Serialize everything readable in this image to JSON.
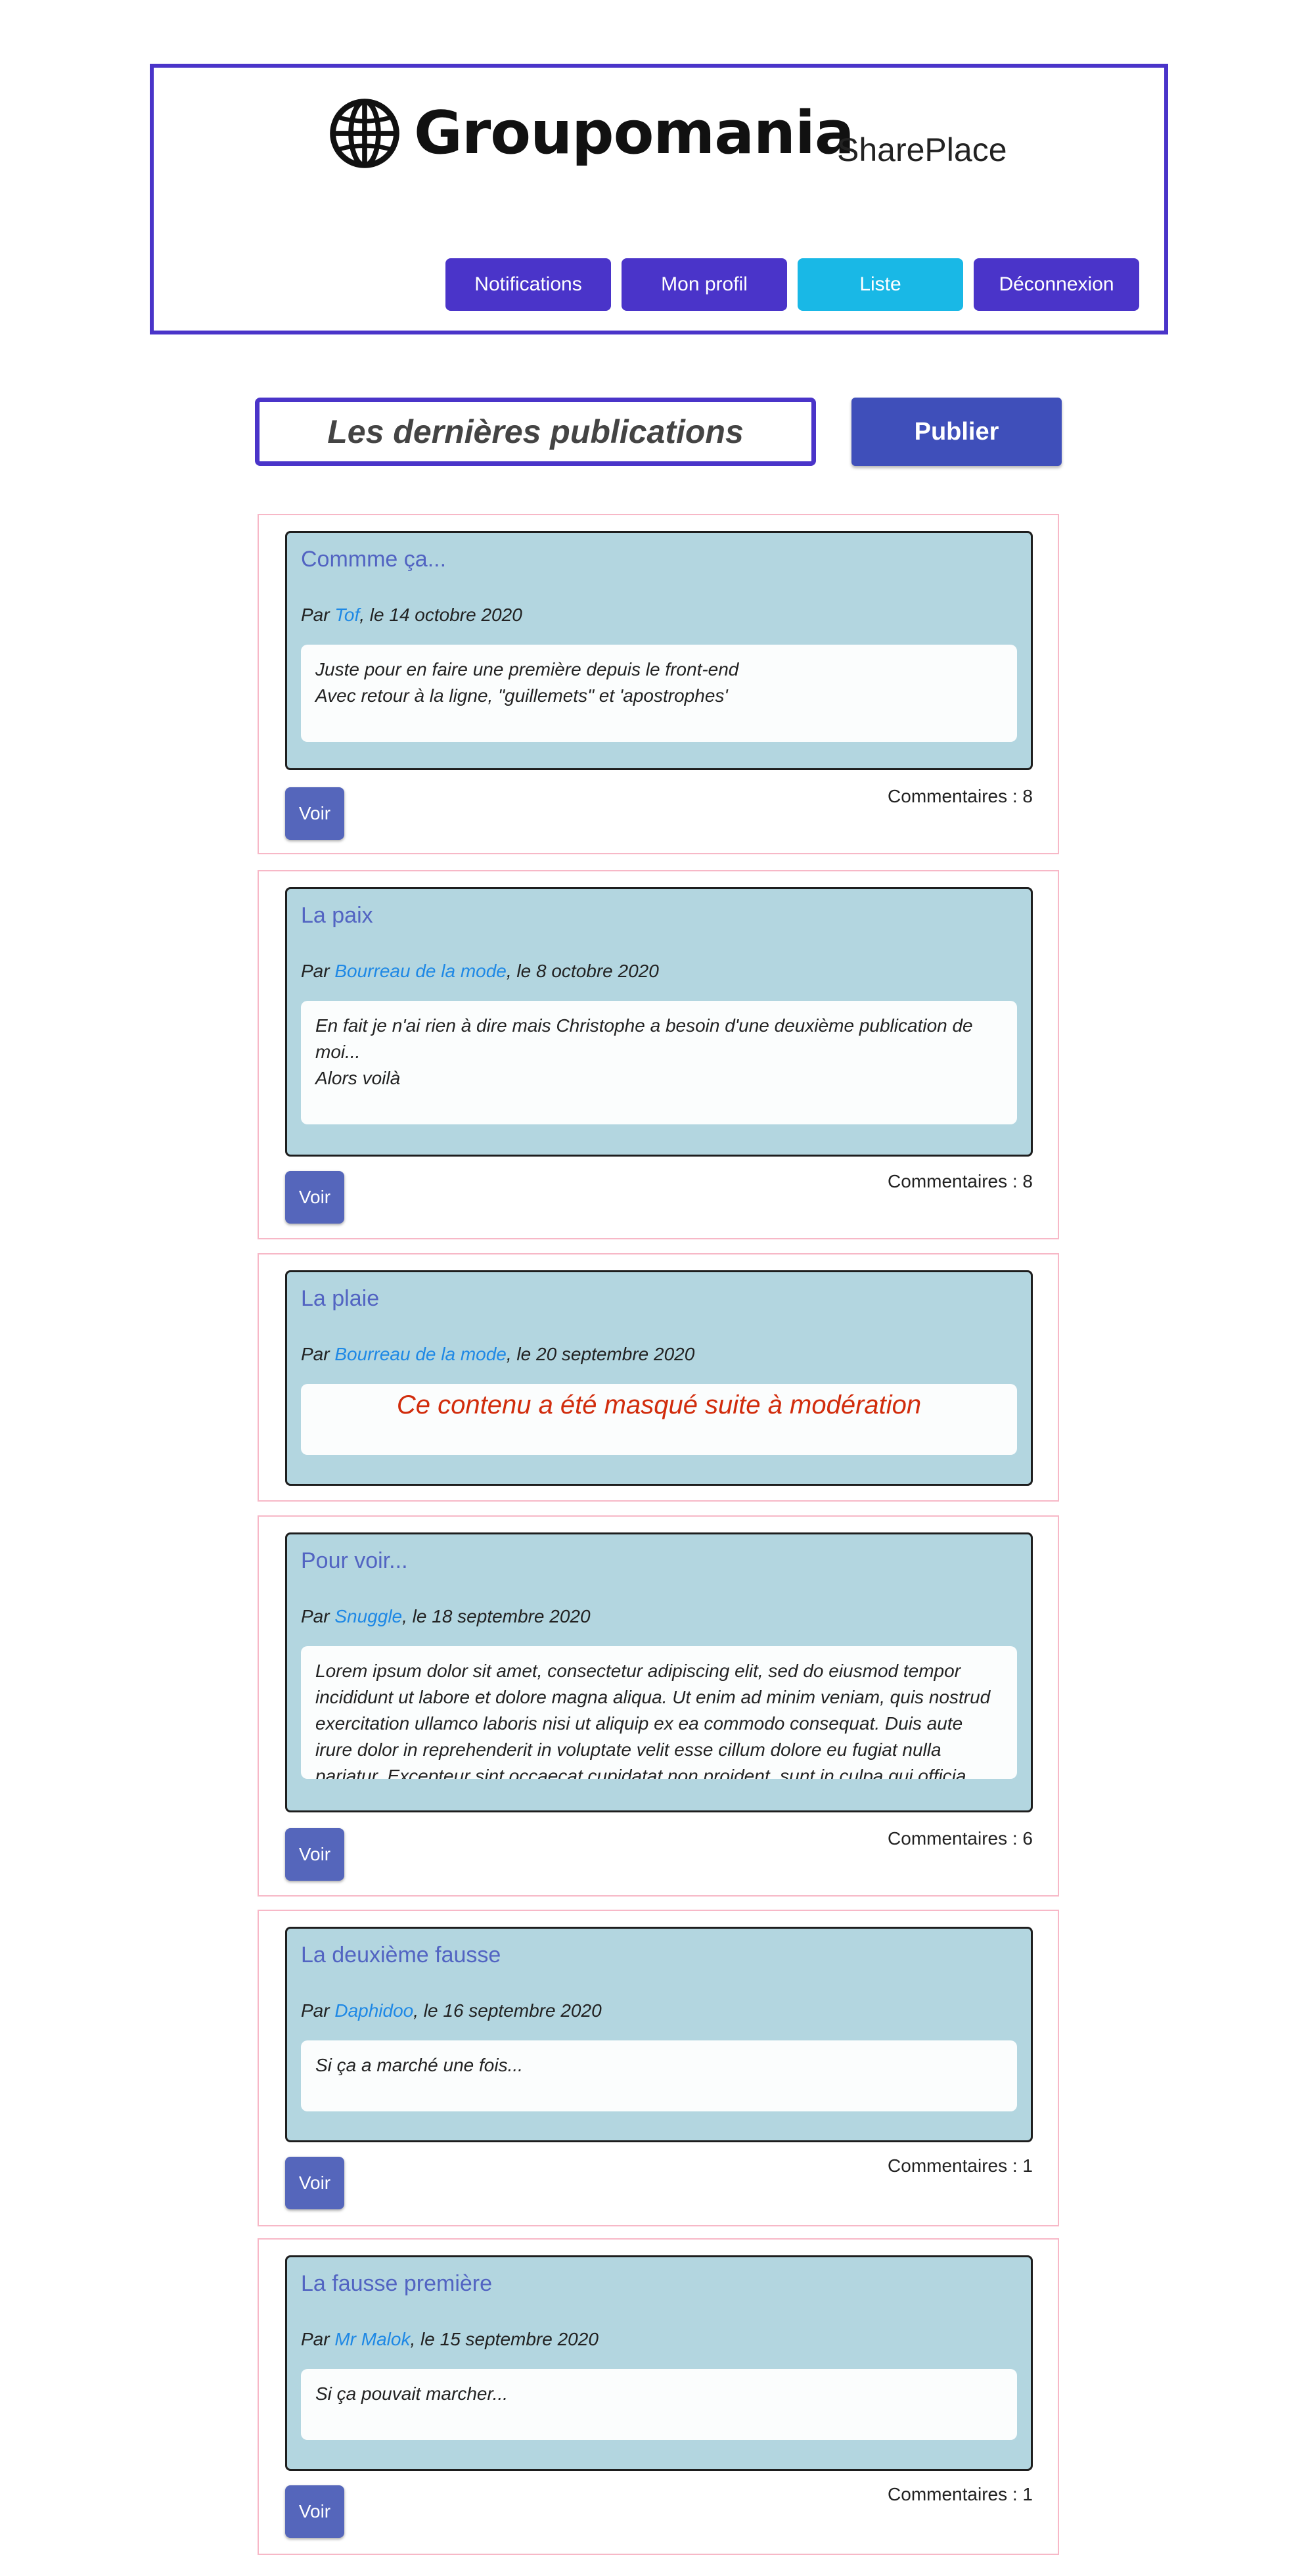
{
  "header": {
    "brand": "Groupomania",
    "tagline": "SharePlace",
    "nav": [
      "Notifications",
      "Mon profil",
      "Liste",
      "Déconnexion"
    ],
    "active_nav": "Liste",
    "colors": {
      "primary": "#4a34c9",
      "active": "#19b8e6"
    }
  },
  "main": {
    "title": "Les dernières publications",
    "publish_label": "Publier"
  },
  "posts": [
    {
      "title": "Commme ça...",
      "by": "Par ",
      "author": "Tof",
      "date": ", le 14 octobre 2020",
      "body": "Juste pour en faire une première depuis le front-end\nAvec retour à la ligne, \"guillemets\" et 'apostrophes'",
      "comments": "Commentaires : 8",
      "voir": "Voir"
    },
    {
      "title": "La paix",
      "by": "Par ",
      "author": "Bourreau de la mode",
      "date": ", le 8 octobre 2020",
      "body": "En fait je n'ai rien à dire mais Christophe a besoin d'une deuxième publication de moi...\nAlors voilà",
      "comments": "Commentaires : 8",
      "voir": "Voir"
    },
    {
      "title": "La plaie",
      "by": "Par ",
      "author": "Bourreau de la mode",
      "date": ", le 20 septembre 2020",
      "body": "Ce contenu a été masqué suite à modération",
      "masked": true
    },
    {
      "title": "Pour voir...",
      "by": "Par ",
      "author": "Snuggle",
      "date": ", le 18 septembre 2020",
      "body": "Lorem ipsum dolor sit amet, consectetur adipiscing elit, sed do eiusmod tempor incididunt ut labore et dolore magna aliqua. Ut enim ad minim veniam, quis nostrud exercitation ullamco laboris nisi ut aliquip ex ea commodo consequat. Duis aute irure dolor in reprehenderit in voluptate velit esse cillum dolore eu fugiat nulla pariatur. Excepteur sint occaecat cupidatat non proident, sunt in culpa qui officia",
      "comments": "Commentaires : 6",
      "voir": "Voir"
    },
    {
      "title": "La deuxième fausse",
      "by": "Par ",
      "author": "Daphidoo",
      "date": ", le 16 septembre 2020",
      "body": "Si ça a marché une fois...",
      "comments": "Commentaires : 1",
      "voir": "Voir"
    },
    {
      "title": "La fausse première",
      "by": "Par ",
      "author": "Mr Malok",
      "date": ", le 15 septembre 2020",
      "body": "Si ça pouvait marcher...",
      "comments": "Commentaires : 1",
      "voir": "Voir"
    }
  ]
}
